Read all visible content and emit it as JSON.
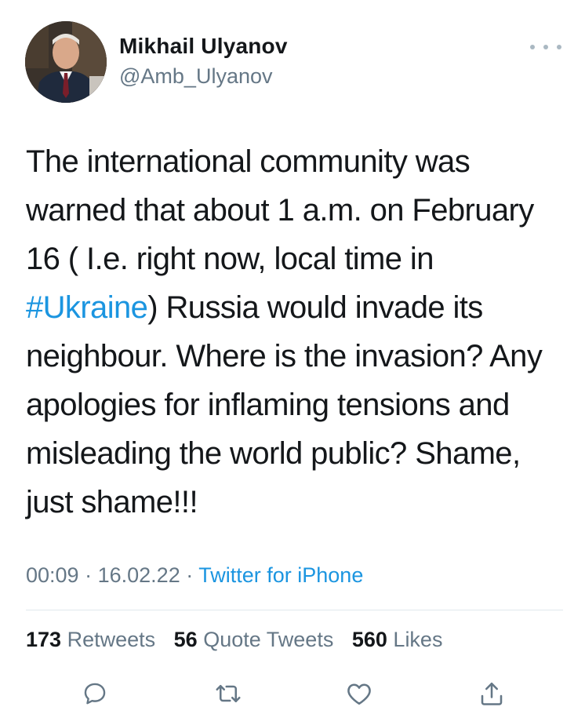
{
  "author": {
    "display_name": "Mikhail Ulyanov",
    "handle": "@Amb_Ulyanov"
  },
  "tweet": {
    "text_before_hashtag": "The international community was warned that about 1 a.m. on February 16 ( I.e. right now, local time in ",
    "hashtag": "#Ukraine",
    "text_after_hashtag": ") Russia would invade its neighbour. Where is the invasion? Any apologies for inflaming tensions and misleading the world public? Shame, just shame!!!",
    "time": "00:09",
    "separator": "·",
    "date": "16.02.22",
    "source": "Twitter for iPhone"
  },
  "stats": {
    "retweets_count": "173",
    "retweets_label": "Retweets",
    "quotes_count": "56",
    "quotes_label": "Quote Tweets",
    "likes_count": "560",
    "likes_label": "Likes"
  },
  "actions": {
    "reply_icon": "reply-icon",
    "retweet_icon": "retweet-icon",
    "like_icon": "heart-icon",
    "share_icon": "share-icon"
  },
  "colors": {
    "link": "#1b95e0",
    "secondary_text": "#657786",
    "primary_text": "#14171a",
    "icon": "#657786"
  }
}
